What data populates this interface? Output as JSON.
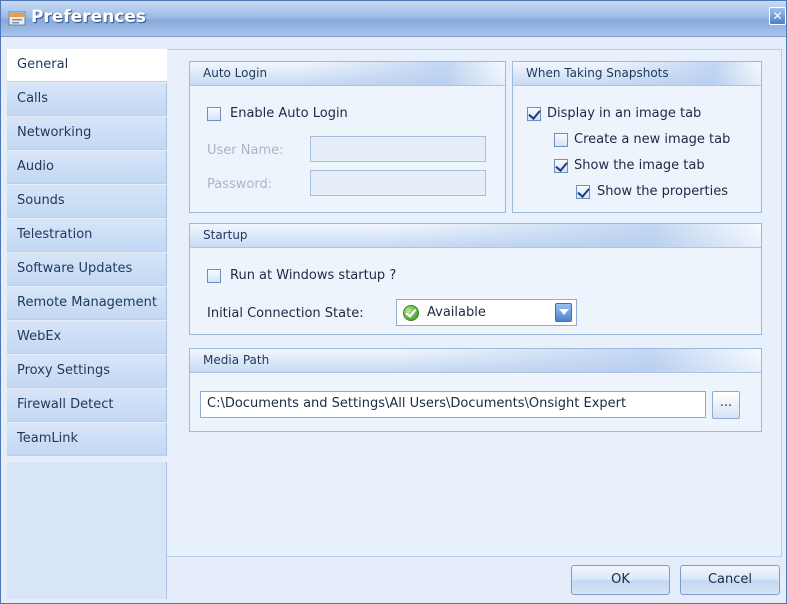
{
  "window": {
    "title": "Preferences",
    "close_label": "✕"
  },
  "sidebar": {
    "items": [
      {
        "label": "General",
        "active": true
      },
      {
        "label": "Calls"
      },
      {
        "label": "Networking"
      },
      {
        "label": "Audio"
      },
      {
        "label": "Sounds"
      },
      {
        "label": "Telestration"
      },
      {
        "label": "Software Updates"
      },
      {
        "label": "Remote Management"
      },
      {
        "label": "WebEx"
      },
      {
        "label": "Proxy Settings"
      },
      {
        "label": "Firewall Detect"
      },
      {
        "label": "TeamLink"
      }
    ]
  },
  "auto_login": {
    "title": "Auto Login",
    "enable_label": "Enable Auto Login",
    "enable_checked": false,
    "username_label": "User Name:",
    "username_value": "",
    "password_label": "Password:",
    "password_value": ""
  },
  "snapshots": {
    "title": "When Taking Snapshots",
    "display_label": "Display in an image tab",
    "display_checked": true,
    "new_tab_label": "Create a new image tab",
    "new_tab_checked": false,
    "show_tab_label": "Show the image tab",
    "show_tab_checked": true,
    "show_props_label": "Show the properties",
    "show_props_checked": true
  },
  "startup": {
    "title": "Startup",
    "run_label": "Run at Windows startup ?",
    "run_checked": false,
    "state_label": "Initial Connection State:",
    "state_value": "Available"
  },
  "media": {
    "title": "Media Path",
    "path_value": "C:\\Documents and Settings\\All Users\\Documents\\Onsight Expert",
    "browse_label": "..."
  },
  "footer": {
    "ok_label": "OK",
    "cancel_label": "Cancel"
  },
  "colors": {
    "accent": "#4f7fc9",
    "title_gradient_mid": "#87a9dc",
    "status_green": "#4da832"
  }
}
